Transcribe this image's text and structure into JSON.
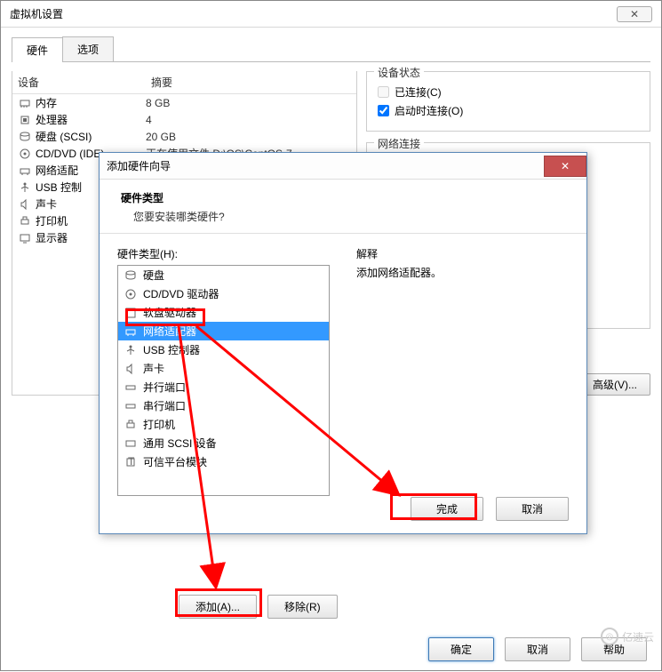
{
  "window": {
    "title": "虚拟机设置",
    "close_glyph": "✕"
  },
  "tabs": {
    "hardware": "硬件",
    "options": "选项"
  },
  "devtable": {
    "col1": "设备",
    "col2": "摘要",
    "rows": [
      {
        "name": "内存",
        "summary": "8 GB",
        "icon": "memory"
      },
      {
        "name": "处理器",
        "summary": "4",
        "icon": "cpu"
      },
      {
        "name": "硬盘 (SCSI)",
        "summary": "20 GB",
        "icon": "disk"
      },
      {
        "name": "CD/DVD (IDE)",
        "summary": "正在使用文件 D:\\OS\\CentOS-7-...",
        "icon": "cd"
      },
      {
        "name": "网络适配",
        "summary": "",
        "icon": "net"
      },
      {
        "name": "USB 控制",
        "summary": "",
        "icon": "usb"
      },
      {
        "name": "声卡",
        "summary": "",
        "icon": "sound"
      },
      {
        "name": "打印机",
        "summary": "",
        "icon": "printer"
      },
      {
        "name": "显示器",
        "summary": "",
        "icon": "display"
      }
    ]
  },
  "statusbox": {
    "title": "设备状态",
    "connected": "已连接(C)",
    "connect_on_start": "启动时连接(O)"
  },
  "netbox": {
    "title": "网络连接"
  },
  "advanced_btn": "高级(V)...",
  "parent_buttons": {
    "add": "添加(A)...",
    "remove": "移除(R)",
    "ok": "确定",
    "cancel": "取消",
    "help": "帮助"
  },
  "wizard": {
    "title": "添加硬件向导",
    "close_glyph": "✕",
    "header": "硬件类型",
    "subheader": "您要安装哪类硬件?",
    "list_label": "硬件类型(H):",
    "desc_label": "解释",
    "desc_text": "添加网络适配器。",
    "items": [
      {
        "label": "硬盘",
        "icon": "disk"
      },
      {
        "label": "CD/DVD 驱动器",
        "icon": "cd"
      },
      {
        "label": "软盘驱动器",
        "icon": "floppy"
      },
      {
        "label": "网络适配器",
        "icon": "net",
        "selected": true
      },
      {
        "label": "USB 控制器",
        "icon": "usb"
      },
      {
        "label": "声卡",
        "icon": "sound"
      },
      {
        "label": "并行端口",
        "icon": "port"
      },
      {
        "label": "串行端口",
        "icon": "port"
      },
      {
        "label": "打印机",
        "icon": "printer"
      },
      {
        "label": "通用 SCSI 设备",
        "icon": "scsi"
      },
      {
        "label": "可信平台模块",
        "icon": "tpm"
      }
    ],
    "finish": "完成",
    "cancel": "取消"
  },
  "watermark": "亿速云"
}
